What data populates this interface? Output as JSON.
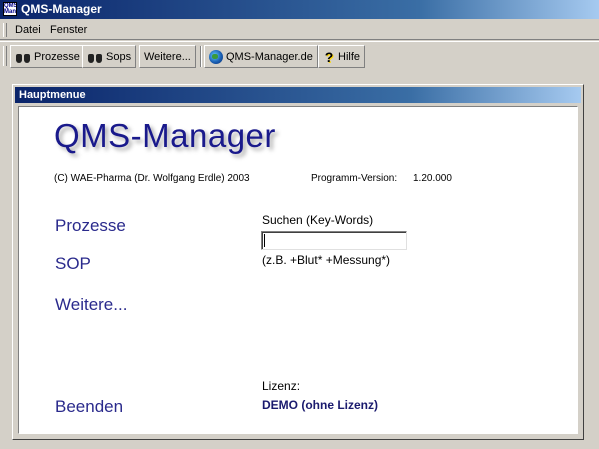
{
  "window": {
    "title": "QMS-Manager",
    "icon_text": "QMS Man"
  },
  "menu": {
    "items": [
      {
        "label": "Datei"
      },
      {
        "label": "Fenster"
      }
    ]
  },
  "toolbar": {
    "buttons": [
      {
        "label": "Prozesse",
        "icon": "binoculars-icon"
      },
      {
        "label": "Sops",
        "icon": "binoculars-icon"
      },
      {
        "label": "Weitere...",
        "icon": ""
      },
      {
        "label": "QMS-Manager.de",
        "icon": "globe-icon"
      },
      {
        "label": "Hilfe",
        "icon": "help-icon"
      }
    ]
  },
  "child_window": {
    "title": "Hauptmenue"
  },
  "main": {
    "logo": "QMS-Manager",
    "copyright": "(C) WAE-Pharma (Dr. Wolfgang Erdle) 2003",
    "version_label": "Programm-Version:",
    "version_value": "1.20.000",
    "nav": {
      "prozesse": "Prozesse",
      "sop": "SOP",
      "weitere": "Weitere...",
      "beenden": "Beenden"
    },
    "search": {
      "label": "Suchen (Key-Words)",
      "value": "",
      "hint": "(z.B. +Blut* +Messung*)"
    },
    "license": {
      "label": "Lizenz:",
      "value": "DEMO (ohne Lizenz)"
    }
  },
  "colors": {
    "titlebar_start": "#0a246a",
    "titlebar_end": "#a6caf0",
    "nav_text": "#2a2a8c",
    "logo_text": "#1a1a8c",
    "face": "#d4d0c8"
  }
}
